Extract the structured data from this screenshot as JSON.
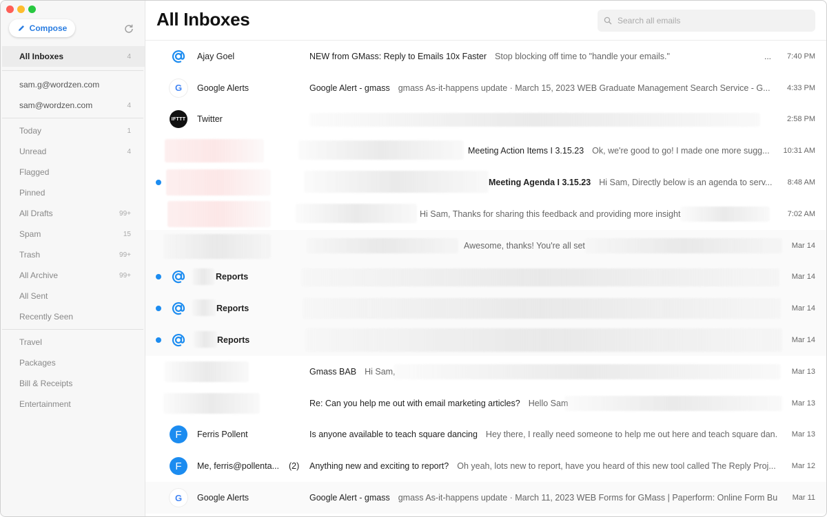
{
  "app": {
    "title": "All Inboxes",
    "compose_label": "Compose",
    "search_placeholder": "Search all emails",
    "accent_color": "#1c8cf0"
  },
  "sidebar": {
    "primary": {
      "label": "All Inboxes",
      "count": "4"
    },
    "accounts": [
      {
        "label": "sam.g@wordzen.com",
        "count": ""
      },
      {
        "label": "sam@wordzen.com",
        "count": "4"
      }
    ],
    "mailboxes": [
      {
        "label": "Today",
        "count": "1"
      },
      {
        "label": "Unread",
        "count": "4"
      },
      {
        "label": "Flagged",
        "count": ""
      },
      {
        "label": "Pinned",
        "count": ""
      },
      {
        "label": "All Drafts",
        "count": "99+"
      },
      {
        "label": "Spam",
        "count": "15"
      },
      {
        "label": "Trash",
        "count": "99+"
      },
      {
        "label": "All Archive",
        "count": "99+"
      },
      {
        "label": "All Sent",
        "count": ""
      },
      {
        "label": "Recently Seen",
        "count": ""
      }
    ],
    "folders": [
      {
        "label": "Travel"
      },
      {
        "label": "Packages"
      },
      {
        "label": "Bill & Receipts"
      },
      {
        "label": "Entertainment"
      }
    ]
  },
  "emails": [
    {
      "sender": "Ajay Goel",
      "subject": "NEW from GMass: Reply to Emails 10x Faster",
      "preview": "Stop blocking off time to \"handle your emails.\"",
      "time": "7:40 PM",
      "ellipsis": "..."
    },
    {
      "sender": "Google Alerts",
      "subject": "Google Alert - gmass",
      "preview": "gmass As-it-happens update · March 15, 2023 WEB Graduate Management Search Service - G...",
      "time": "4:33 PM",
      "avatar_text": "G"
    },
    {
      "sender": "Twitter",
      "subject": "",
      "preview": "",
      "time": "2:58 PM",
      "avatar_text": "IFTTT"
    },
    {
      "sender": "",
      "subject": "Meeting Action Items I 3.15.23",
      "preview": "Ok, we're good to go! I made one more sugg...",
      "time": "10:31 AM"
    },
    {
      "sender": "",
      "subject": "Meeting Agenda I 3.15.23",
      "preview": "Hi Sam, Directly below is an agenda to serv...",
      "time": "8:48 AM"
    },
    {
      "sender": "",
      "subject": "",
      "preview": "Hi Sam, Thanks for sharing this feedback and providing more insight",
      "time": "7:02 AM"
    },
    {
      "sender": "",
      "subject": "",
      "preview": "Awesome, thanks! You're all set",
      "time": "Mar 14"
    },
    {
      "sender": "Reports",
      "subject": "",
      "preview": "",
      "time": "Mar 14"
    },
    {
      "sender": "Reports",
      "subject": "",
      "preview": "",
      "time": "Mar 14"
    },
    {
      "sender": "Reports",
      "subject": "",
      "preview": "",
      "time": "Mar 14"
    },
    {
      "sender": "",
      "subject": "Gmass BAB",
      "preview": "Hi Sam,",
      "time": "Mar 13"
    },
    {
      "sender": "",
      "subject": "Re: Can you help me out with email marketing articles?",
      "preview": "Hello Sam",
      "time": "Mar 13"
    },
    {
      "sender": "Ferris Pollent",
      "subject": "Is anyone available to teach square dancing",
      "preview": "Hey there, I really need someone to help me out here and teach square dan...",
      "time": "Mar 13",
      "avatar_text": "F"
    },
    {
      "sender": "Me, ferris@pollenta...",
      "count": "(2)",
      "subject": "Anything new and exciting to report?",
      "preview": "Oh yeah, lots new to report, have you heard of this new tool called The Reply Proj...",
      "time": "Mar 12",
      "avatar_text": "F"
    },
    {
      "sender": "Google Alerts",
      "subject": "Google Alert - gmass",
      "preview": "gmass As-it-happens update · March 11, 2023 WEB Forms for GMass | Paperform: Online Form Bu...",
      "time": "Mar 11",
      "avatar_text": "G"
    }
  ]
}
